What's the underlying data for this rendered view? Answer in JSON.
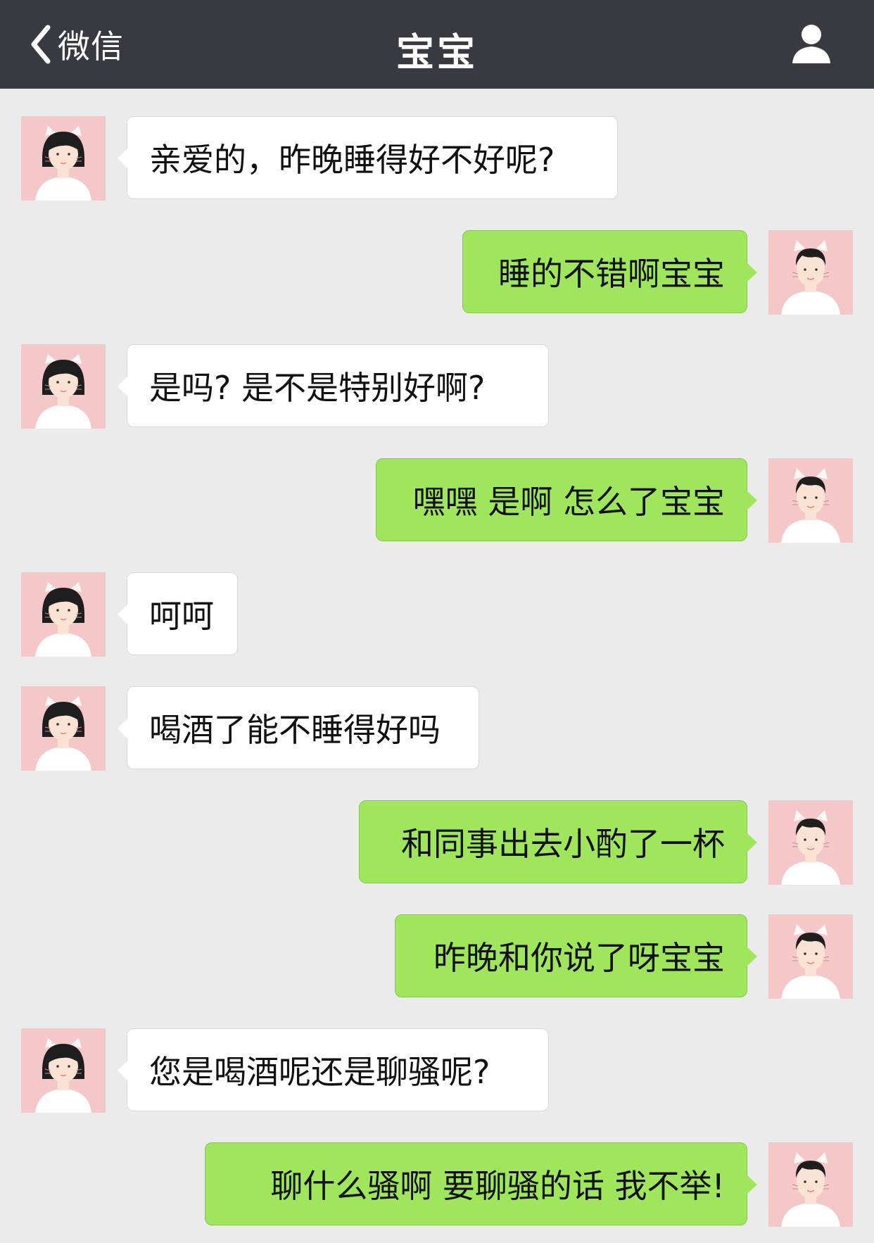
{
  "header": {
    "back_label": "微信",
    "title": "宝宝",
    "back_icon": "chevron-left-icon",
    "profile_icon": "person-icon"
  },
  "colors": {
    "topbar": "#393a3f",
    "chat_background": "#ebebeb",
    "incoming_bubble": "#ffffff",
    "outgoing_bubble": "#9fe65c",
    "avatar_background": "#f4c7c9"
  },
  "messages": [
    {
      "side": "left",
      "text": "亲爱的，昨晚睡得好不好呢?"
    },
    {
      "side": "right",
      "text": "睡的不错啊宝宝"
    },
    {
      "side": "left",
      "text": "是吗? 是不是特别好啊?"
    },
    {
      "side": "right",
      "text": "嘿嘿 是啊 怎么了宝宝"
    },
    {
      "side": "left",
      "text": "呵呵"
    },
    {
      "side": "left",
      "text": "喝酒了能不睡得好吗"
    },
    {
      "side": "right",
      "text": "和同事出去小酌了一杯"
    },
    {
      "side": "right",
      "text": "昨晚和你说了呀宝宝"
    },
    {
      "side": "left",
      "text": "您是喝酒呢还是聊骚呢?"
    },
    {
      "side": "right",
      "text": "聊什么骚啊 要聊骚的话 我不举!"
    }
  ]
}
